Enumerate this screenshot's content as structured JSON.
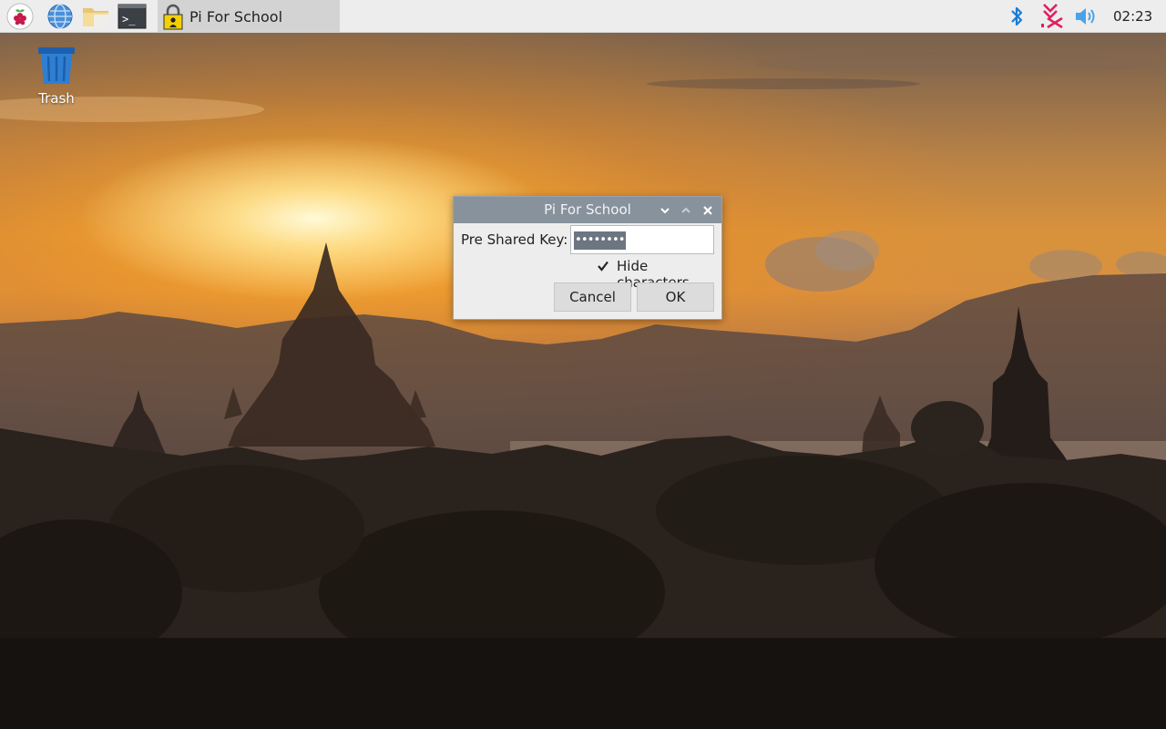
{
  "taskbar": {
    "menu_icon": "raspberry-menu-icon",
    "launchers": [
      "web-browser-icon",
      "file-manager-icon",
      "terminal-icon"
    ],
    "terminal_glyph": ">_",
    "active_task": {
      "label": "Pi For School",
      "icon": "network-lock-icon"
    },
    "tray": {
      "bluetooth_icon": "bluetooth-icon",
      "network_icon": "network-disconnected-icon",
      "volume_icon": "volume-icon",
      "clock": "02:23"
    },
    "colors": {
      "background": "#ededed",
      "active_task_bg": "#d3d3d3",
      "bluetooth": "#1a7bd6",
      "network_error": "#e02060",
      "volume": "#4aa3e8"
    }
  },
  "desktop": {
    "icons": [
      {
        "label": "Trash",
        "icon": "trash-icon"
      }
    ]
  },
  "dialog": {
    "title": "Pi For School",
    "key_label": "Pre Shared Key:",
    "key_value_masked": "••••••••",
    "hide_characters_label": "Hide characters",
    "hide_characters_checked": true,
    "cancel_label": "Cancel",
    "ok_label": "OK",
    "window_controls": [
      "minimize-icon",
      "maximize-icon",
      "close-icon"
    ],
    "colors": {
      "titlebar": "#87929c",
      "selection": "#6b7681"
    }
  }
}
